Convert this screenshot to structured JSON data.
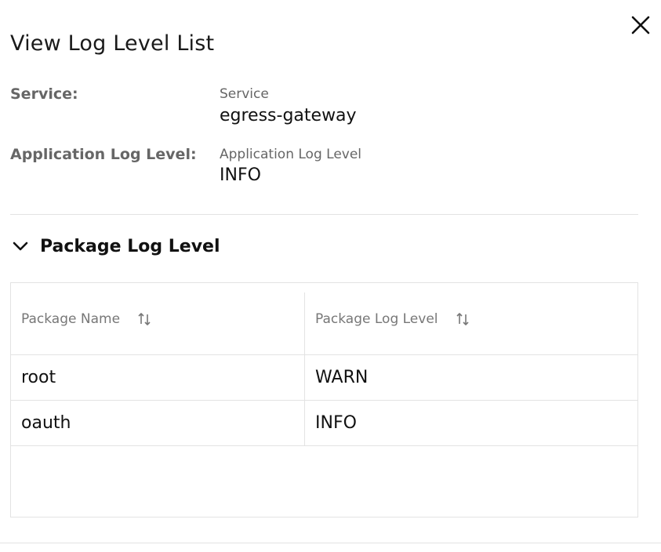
{
  "dialog": {
    "title": "View Log Level List",
    "close_icon": "close-icon"
  },
  "fields": {
    "service": {
      "label": "Service:",
      "caption": "Service",
      "value": "egress-gateway"
    },
    "app_log_level": {
      "label": "Application Log Level:",
      "caption": "Application Log Level",
      "value": "INFO"
    }
  },
  "package_section": {
    "title": "Package Log Level",
    "expanded": true,
    "toggle_icon": "chevron-down-icon",
    "table": {
      "columns": [
        "Package Name",
        "Package Log Level"
      ],
      "sort_icon": "sort-icon",
      "rows": [
        [
          "root",
          "WARN"
        ],
        [
          "oauth",
          "INFO"
        ]
      ]
    }
  },
  "colors": {
    "label_gray": "#666666",
    "border": "#e3e3e3",
    "text": "#111111"
  }
}
